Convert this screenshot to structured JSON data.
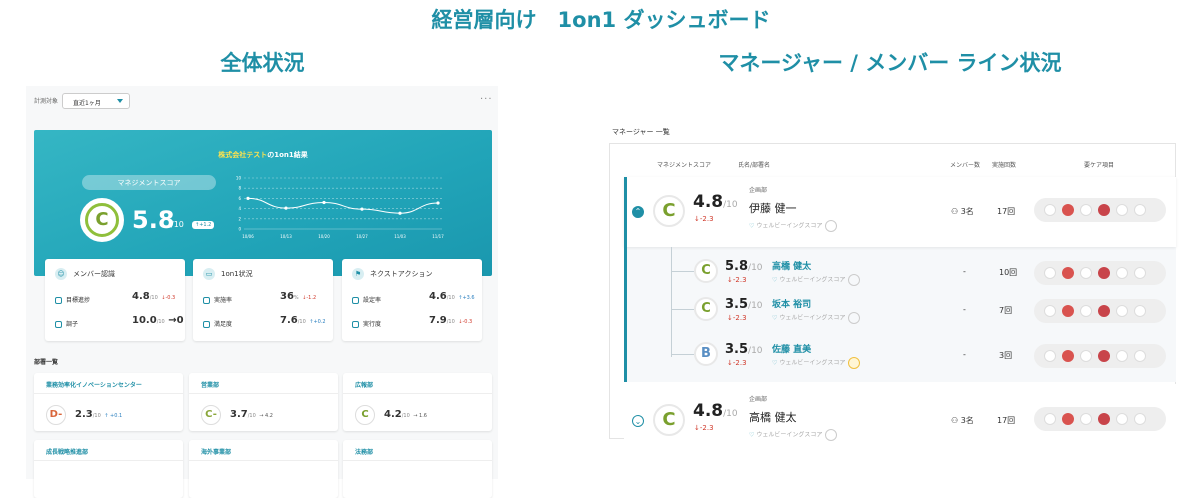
{
  "headings": {
    "main": "経営層向け　1on1 ダッシュボード",
    "left": "全体状況",
    "right": "マネージャー / メンバー ライン状況"
  },
  "overview": {
    "period_label": "計測対象",
    "period_value": "直近1ヶ月",
    "more_label": "···",
    "hero": {
      "company": "株式会社テスト",
      "title_suffix": "の1on1結果",
      "score_label": "マネジメントスコア",
      "grade": "C",
      "score": "5.8",
      "denominator": "/10",
      "delta": "+1.2"
    },
    "chart_data": {
      "type": "line",
      "x": [
        "10/06",
        "10/13",
        "10/20",
        "10/27",
        "11/03",
        "11/17"
      ],
      "y_ticks": [
        "10",
        "8",
        "6",
        "4",
        "2",
        "0"
      ],
      "ylim": [
        0,
        10
      ],
      "series": [
        {
          "values": [
            6.0,
            4.1,
            5.2,
            3.9,
            3.1,
            5.1
          ]
        }
      ],
      "colors": {
        "line": "#ffffff"
      }
    },
    "cards": [
      {
        "title": "メンバー認識",
        "icon": "person-icon",
        "rows": [
          {
            "label": "目標進捗",
            "value": "4.8",
            "den": "/10",
            "delta": "-0.3",
            "dir": "down"
          },
          {
            "label": "調子",
            "value": "10.0",
            "den": "/10",
            "delta": "0",
            "dir": "flat"
          }
        ]
      },
      {
        "title": "1on1状況",
        "icon": "chat-icon",
        "rows": [
          {
            "label": "実施率",
            "value": "36",
            "den": "%",
            "delta": "-1.2",
            "dir": "down"
          },
          {
            "label": "満足度",
            "value": "7.6",
            "den": "/10",
            "delta": "+0.2",
            "dir": "up"
          }
        ]
      },
      {
        "title": "ネクストアクション",
        "icon": "flag-icon",
        "rows": [
          {
            "label": "設定率",
            "value": "4.6",
            "den": "/10",
            "delta": "+3.6",
            "dir": "up"
          },
          {
            "label": "実行度",
            "value": "7.9",
            "den": "/10",
            "delta": "-0.3",
            "dir": "down"
          }
        ]
      }
    ],
    "dept_heading": "部署一覧",
    "depts": [
      {
        "name": "業務効率化イノベーションセンター",
        "grade": "D-",
        "score": "2.3",
        "den": "/10",
        "delta": "+0.1",
        "grade_color": "#d9663b",
        "delta_color": "#2a7fbf"
      },
      {
        "name": "営業部",
        "grade": "C-",
        "score": "3.7",
        "den": "/10",
        "delta": "4.2",
        "grade_color": "#8aa63a",
        "delta_color": "#555"
      },
      {
        "name": "広報部",
        "grade": "C",
        "score": "4.2",
        "den": "/10",
        "delta": "1.6",
        "grade_color": "#7aa02e",
        "delta_color": "#555"
      },
      {
        "name": "成長戦略推進部",
        "grade": "",
        "score": "",
        "den": "",
        "delta": ""
      },
      {
        "name": "海外事業部",
        "grade": "",
        "score": "",
        "den": "",
        "delta": ""
      },
      {
        "name": "法務部",
        "grade": "",
        "score": "",
        "den": "",
        "delta": ""
      }
    ]
  },
  "managers": {
    "title": "マネージャー 一覧",
    "columns": {
      "score": "マネジメントスコア",
      "name": "氏名/部署名",
      "members": "メンバー数",
      "count": "実施回数",
      "care": "要ケア項目"
    },
    "wellbeing_label": "ウェルビーイングスコア",
    "rows": [
      {
        "grade": "C",
        "score": "4.8",
        "den": "/10",
        "delta": "-2.3",
        "dept": "企画部",
        "name": "伊藤 健一",
        "members": "3名",
        "count": "17回"
      },
      {
        "grade": "C",
        "score": "4.8",
        "den": "/10",
        "delta": "-2.3",
        "dept": "企画部",
        "name": "高橋 健太",
        "members": "3名",
        "count": "17回"
      }
    ],
    "sub_rows": [
      {
        "grade": "C",
        "score": "5.8",
        "den": "/10",
        "delta": "-2.3",
        "name": "高橋 健太",
        "members": "-",
        "count": "10回",
        "weather": "cloud-icon"
      },
      {
        "grade": "C",
        "score": "3.5",
        "den": "/10",
        "delta": "-2.3",
        "name": "坂本 裕司",
        "members": "-",
        "count": "7回",
        "weather": "cloud-icon"
      },
      {
        "grade": "B",
        "score": "3.5",
        "den": "/10",
        "delta": "-2.3",
        "name": "佐藤 直美",
        "members": "-",
        "count": "3回",
        "weather": "sun-icon"
      }
    ]
  }
}
